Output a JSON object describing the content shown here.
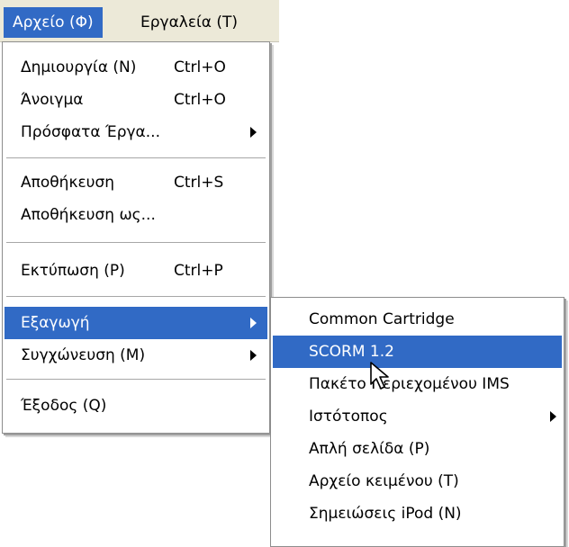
{
  "menubar": {
    "file": "Αρχείο (Φ)",
    "tools": "Εργαλεία (Τ)"
  },
  "file_menu": {
    "items": [
      {
        "label": "Δημιουργία (N)",
        "shortcut": "Ctrl+O"
      },
      {
        "label": "Άνοιγμα",
        "shortcut": "Ctrl+O"
      },
      {
        "label": "Πρόσφατα Έργα...",
        "submenu": true
      },
      {
        "label": "Αποθήκευση",
        "shortcut": "Ctrl+S"
      },
      {
        "label": "Αποθήκευση ως..."
      },
      {
        "label": "Εκτύπωση (P)",
        "shortcut": "Ctrl+P"
      },
      {
        "label": "Εξαγωγή",
        "submenu": true,
        "highlighted": true
      },
      {
        "label": "Συγχώνευση (M)",
        "submenu": true
      },
      {
        "label": "Έξοδος (Q)"
      }
    ]
  },
  "export_submenu": {
    "items": [
      {
        "label": "Common Cartridge"
      },
      {
        "label": "SCORM 1.2",
        "highlighted": true
      },
      {
        "label": "Πακέτο Περιεχομένου IMS"
      },
      {
        "label": "Ιστότοπος",
        "submenu": true
      },
      {
        "label": "Απλή σελίδα (P)"
      },
      {
        "label": "Αρχείο κειμένου (T)"
      },
      {
        "label": "Σημειώσεις iPod (N)"
      }
    ]
  },
  "colors": {
    "highlight": "#316ac5",
    "menubar": "#ece9d8"
  },
  "cursor_icon": "mouse-pointer-icon"
}
